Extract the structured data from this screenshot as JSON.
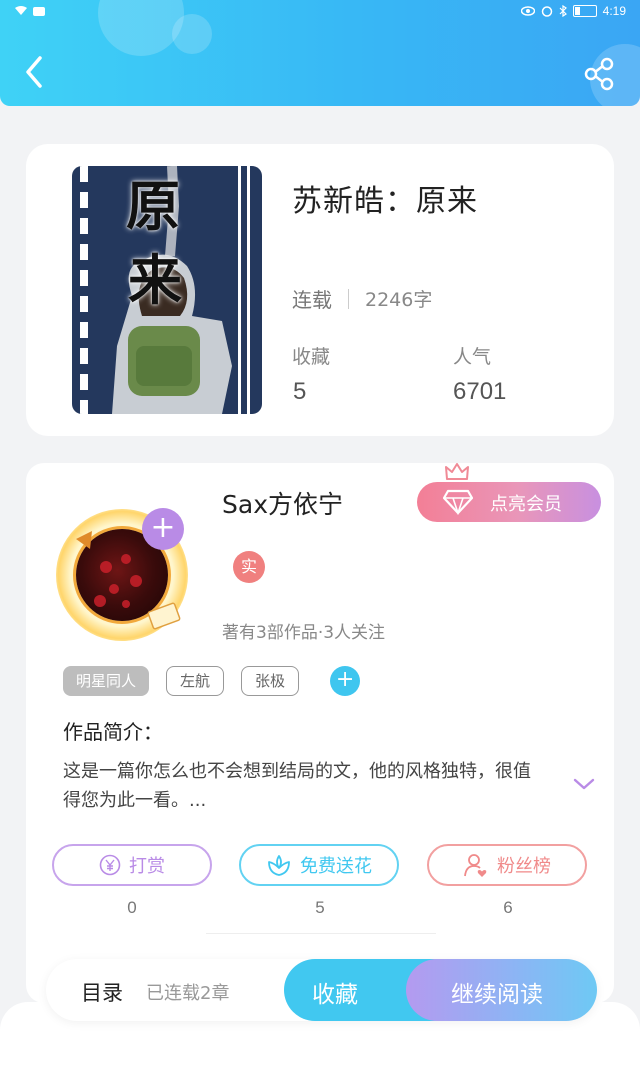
{
  "status_bar": {
    "time": "4:19"
  },
  "book": {
    "title": "苏新皓：原来",
    "cover_text": [
      "原",
      "来"
    ],
    "status": "连载",
    "word_count": "2246字",
    "favorites_label": "收藏",
    "favorites_value": "5",
    "popularity_label": "人气",
    "popularity_value": "6701"
  },
  "author": {
    "name": "Sax方依宁",
    "verified_badge": "实",
    "works_info": "著有3部作品·3人关注",
    "vip_button": "点亮会员"
  },
  "tags": [
    "明星同人",
    "左航",
    "张极"
  ],
  "intro": {
    "title": "作品简介：",
    "text": "这是一篇你怎么也不会想到结局的文，他的风格独特，很值得您为此一看。..."
  },
  "actions": [
    {
      "label": "打赏",
      "count": "0",
      "color": "#b98be6"
    },
    {
      "label": "免费送花",
      "count": "5",
      "color": "#41c8f0"
    },
    {
      "label": "粉丝榜",
      "count": "6",
      "color": "#f08a8a"
    }
  ],
  "bottom_bar": {
    "toc_label": "目录",
    "toc_status": "已连载2章",
    "favorite_button": "收藏",
    "read_button": "继续阅读"
  },
  "colors": {
    "header": "#38b8f5",
    "accent_blue": "#41c8f0",
    "accent_purple": "#b98be6",
    "accent_pink": "#f08a8a"
  }
}
